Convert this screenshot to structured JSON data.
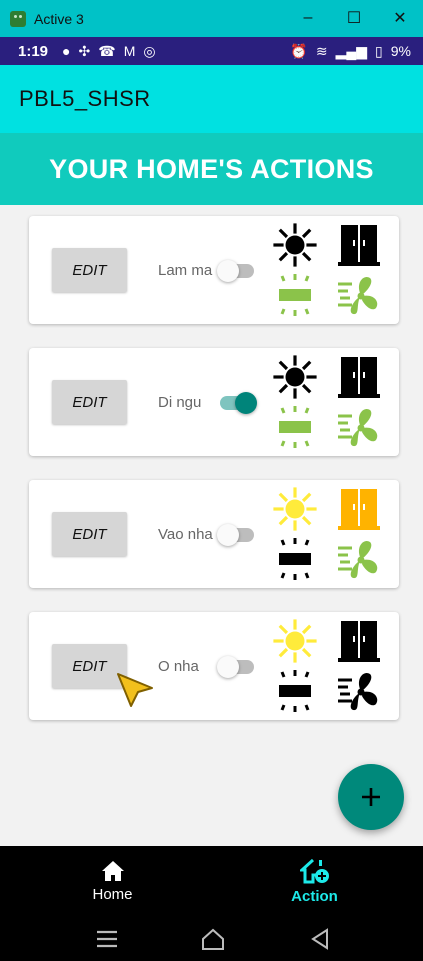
{
  "window": {
    "title": "Active 3",
    "controls": [
      "–",
      "☐",
      "✕"
    ]
  },
  "status_bar": {
    "time": "1:19",
    "battery": "9%"
  },
  "app_bar": {
    "title": "PBL5_SHSR"
  },
  "header": {
    "title": "YOUR HOME'S ACTIONS"
  },
  "actions": [
    {
      "edit_label": "EDIT",
      "name": "Lam ma",
      "enabled": false,
      "light": "off",
      "door": "closed",
      "window": "open",
      "fan": "on"
    },
    {
      "edit_label": "EDIT",
      "name": "Di ngu",
      "enabled": true,
      "light": "off",
      "door": "closed",
      "window": "open",
      "fan": "on"
    },
    {
      "edit_label": "EDIT",
      "name": "Vao nha",
      "enabled": false,
      "light": "on",
      "door": "open",
      "window": "closed",
      "fan": "on"
    },
    {
      "edit_label": "EDIT",
      "name": "O nha",
      "enabled": false,
      "light": "on",
      "door": "closed",
      "window": "closed",
      "fan": "off"
    }
  ],
  "nav": {
    "home_label": "Home",
    "action_label": "Action",
    "active": "action"
  },
  "colors": {
    "app_bar": "#00e1e1",
    "header": "#10cbbd",
    "accent": "#00897b",
    "on_green": "#8bc34a",
    "light_on": "#ffeb3b",
    "door_open": "#ffb300",
    "nav_active": "#1de9e9"
  }
}
